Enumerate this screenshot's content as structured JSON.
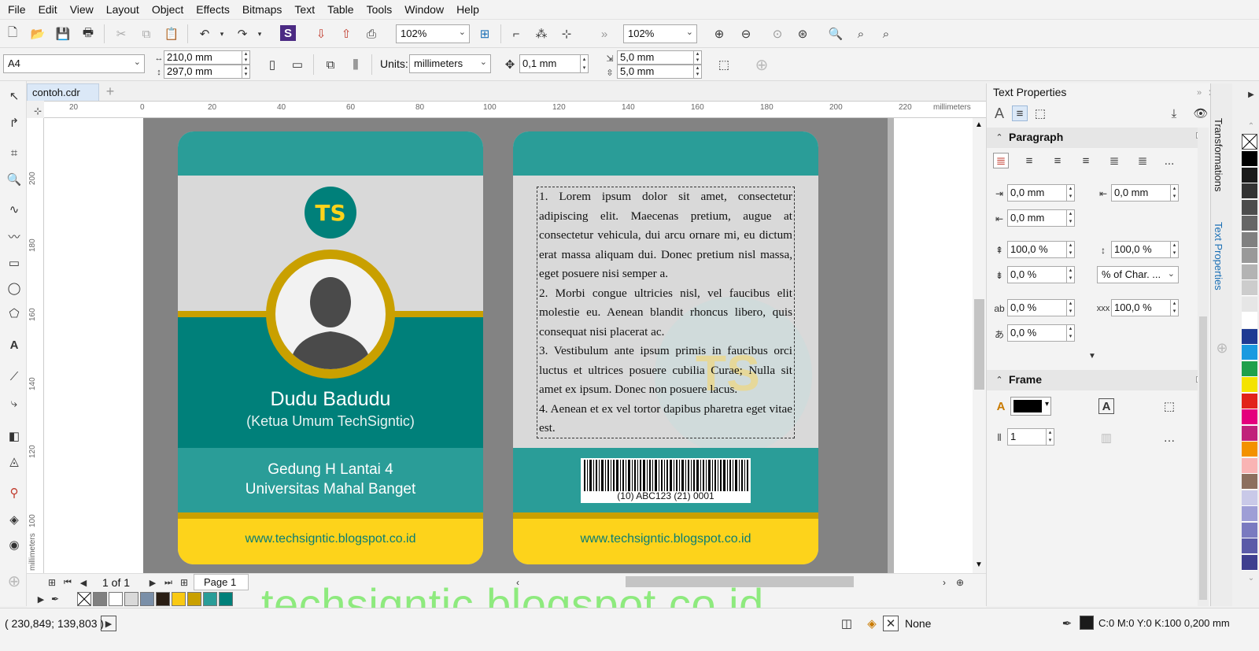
{
  "menu": [
    "File",
    "Edit",
    "View",
    "Layout",
    "Object",
    "Effects",
    "Bitmaps",
    "Text",
    "Table",
    "Tools",
    "Window",
    "Help"
  ],
  "toolbar1": {
    "zoom1": "102%",
    "zoom2": "102%"
  },
  "toolbar2": {
    "page_size": "A4",
    "width": "210,0 mm",
    "height": "297,0 mm",
    "units_label": "Units:",
    "units_value": "millimeters",
    "nudge": "0,1 mm",
    "dup_x": "5,0 mm",
    "dup_y": "5,0 mm"
  },
  "document_tab": "contoh.cdr",
  "ruler_h": [
    "20",
    "0",
    "20",
    "40",
    "60",
    "80",
    "100",
    "120",
    "140",
    "160",
    "180",
    "200",
    "220"
  ],
  "ruler_h_unit": "millimeters",
  "ruler_v": [
    "200",
    "180",
    "160",
    "140",
    "120",
    "100"
  ],
  "ruler_v_unit": "millimeters",
  "card_front": {
    "logo": "TS",
    "name": "Dudu Badudu",
    "role": "(Ketua Umum TechSigntic)",
    "address1": "Gedung H Lantai 4",
    "address2": "Universitas Mahal Banget",
    "url": "www.techsigntic.blogspot.co.id"
  },
  "card_back": {
    "paragraphs": [
      "1. Lorem ipsum dolor sit amet, consectetur adipiscing elit. Maecenas pretium, augue at consectetur vehicula, dui arcu ornare mi, eu dictum erat massa aliquam dui. Donec pretium nisl massa, eget posuere nisi semper a.",
      "2. Morbi congue ultricies nisl, vel faucibus elit molestie eu. Aenean blandit rhoncus libero, quis consequat nisi placerat ac.",
      "3. Vestibulum ante ipsum primis in faucibus orci luctus et ultrices posuere cubilia Curae; Nulla sit amet ex ipsum. Donec non posuere lacus.",
      "4. Aenean et ex vel tortor dapibus pharetra eget vitae est."
    ],
    "barcode_text": "(10) ABC123 (21) 0001",
    "url": "www.techsigntic.blogspot.co.id"
  },
  "page_nav": {
    "count": "1 of 1",
    "page_tab": "Page 1"
  },
  "docker": {
    "title": "Text Properties",
    "paragraph": {
      "header": "Paragraph",
      "left_indent": "0,0 mm",
      "first_line_indent": "0,0 mm",
      "right_indent": "0,0 mm",
      "before_spacing": "100,0 %",
      "line_spacing": "100,0 %",
      "after_spacing": "0,0 %",
      "spacing_unit": "% of Char. ...",
      "char_spacing": "0,0 %",
      "word_spacing": "100,0 %",
      "language_spacing": "0,0 %"
    },
    "frame": {
      "header": "Frame",
      "columns": "1"
    },
    "more": "..."
  },
  "vertical_tabs": [
    "Transformations",
    "Text Properties"
  ],
  "status": {
    "coords": "( 230,849; 139,803 )",
    "fill": "None",
    "outline": "C:0 M:0 Y:0 K:100  0,200 mm"
  },
  "watermark": "techsigntic.blogspot.co.id",
  "colors": {
    "teal_dark": "#00807a",
    "teal": "#2a9d98",
    "gold": "#c9a000",
    "yellow": "#fdd31b",
    "gray_card": "#d9d9d9",
    "avatar": "#4a4a4a"
  },
  "palette_docked": [
    "#ffffff",
    "#808080",
    "#ffffff",
    "#d9d9d9",
    "#7a8fa8",
    "#2a1e14",
    "#f9c913",
    "#c9a000",
    "#2a9d98",
    "#00807a"
  ],
  "palette_side": [
    "#000000",
    "#1a1a1a",
    "#333333",
    "#4d4d4d",
    "#666666",
    "#808080",
    "#999999",
    "#b3b3b3",
    "#cccccc",
    "#e6e6e6",
    "#ffffff",
    "#1f3a93",
    "#1a9ae0",
    "#1fa04b",
    "#f4e300",
    "#e2231a",
    "#e4007c",
    "#c0227a",
    "#f39200",
    "#f9b4b4",
    "#8c6f5e",
    "#c9c9e8",
    "#9e9ed6",
    "#7a7ac0",
    "#5b5ba8",
    "#3f3f8f"
  ],
  "icons": [
    "new-icon",
    "open-icon",
    "save-icon",
    "print-icon",
    "cut-icon",
    "copy-icon",
    "paste-icon",
    "undo-icon",
    "redo-icon",
    "import-icon",
    "export-icon",
    "zoom-in-icon",
    "zoom-out-icon"
  ]
}
